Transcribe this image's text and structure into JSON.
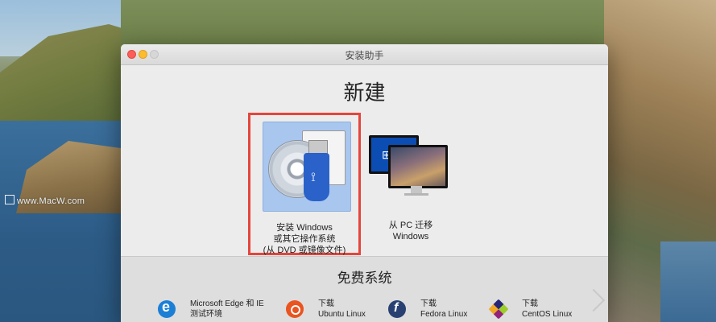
{
  "desktop": {
    "watermark": "www.MacW.com"
  },
  "window": {
    "title": "安装助手",
    "heading": "新建",
    "options": [
      {
        "line1": "安装 Windows",
        "line2": "或其它操作系统",
        "line3": "(从 DVD 或镜像文件)",
        "icon": "dvd-usb-icon",
        "selected": true
      },
      {
        "line1": "从 PC 迁移",
        "line2": "Windows",
        "icon": "pc-migrate-icon",
        "selected": false
      }
    ],
    "free_systems": {
      "title": "免费系统",
      "items": [
        {
          "line1": "Microsoft Edge 和 IE",
          "line2": "测试环境",
          "icon": "edge-icon"
        },
        {
          "line1": "下载",
          "line2": "Ubuntu Linux",
          "icon": "ubuntu-icon"
        },
        {
          "line1": "下载",
          "line2": "Fedora Linux",
          "icon": "fedora-icon"
        },
        {
          "line1": "下载",
          "line2": "CentOS Linux",
          "icon": "centos-icon"
        }
      ]
    }
  },
  "colors": {
    "selection_border": "#e5453c",
    "tile_highlight": "#a9c6ef",
    "close": "#fc5f57",
    "minimize": "#fdbc2e"
  }
}
